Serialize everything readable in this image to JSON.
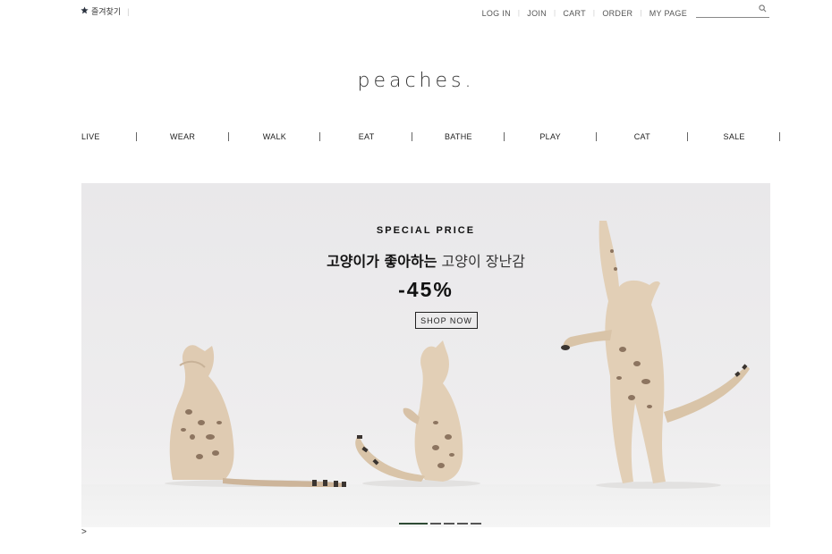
{
  "topbar": {
    "bookmark_label": "즐겨찾기",
    "links": [
      "LOG IN",
      "JOIN",
      "CART",
      "ORDER",
      "MY PAGE"
    ],
    "search_value": ""
  },
  "logo_text": "peaches.",
  "nav": [
    "LIVE",
    "WEAR",
    "WALK",
    "EAT",
    "BATHE",
    "PLAY",
    "CAT",
    "SALE"
  ],
  "banner": {
    "eyebrow": "SPECIAL PRICE",
    "headline_bold": "고양이가 좋아하는",
    "headline_light": "고양이 장난감",
    "discount": "-45%",
    "cta": "SHOP NOW",
    "slide_count": 5,
    "active_slide": 1
  },
  "next_arrow": ">",
  "colors": {
    "accent": "#2e4a34",
    "background": "#ffffff",
    "banner_bg": "#ebeaeb"
  }
}
